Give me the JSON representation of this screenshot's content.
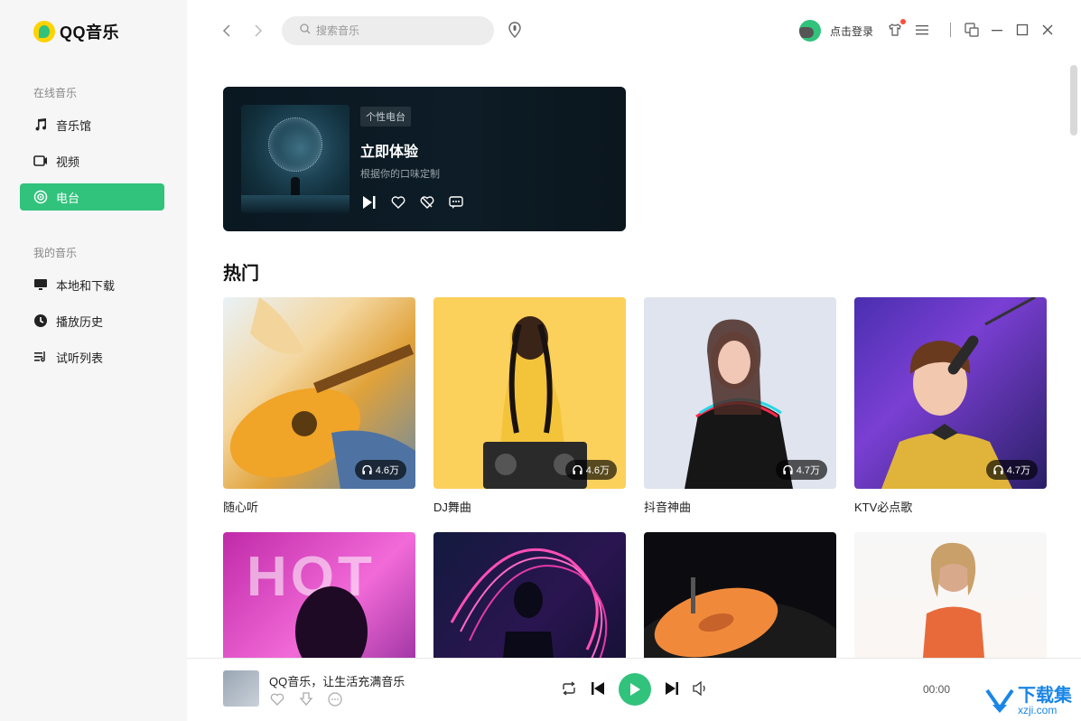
{
  "app": {
    "name": "QQ音乐"
  },
  "sidebar": {
    "online_title": "在线音乐",
    "online_items": [
      {
        "label": "音乐馆",
        "icon": "music-note-icon"
      },
      {
        "label": "视频",
        "icon": "video-icon"
      },
      {
        "label": "电台",
        "icon": "radio-icon",
        "active": true
      }
    ],
    "mine_title": "我的音乐",
    "mine_items": [
      {
        "label": "本地和下载",
        "icon": "monitor-icon"
      },
      {
        "label": "播放历史",
        "icon": "clock-icon"
      },
      {
        "label": "试听列表",
        "icon": "playlist-icon"
      }
    ]
  },
  "topbar": {
    "search_placeholder": "搜索音乐",
    "login_label": "点击登录"
  },
  "banner": {
    "tag": "个性电台",
    "title": "立即体验",
    "subtitle": "根据你的口味定制"
  },
  "hot": {
    "title": "热门",
    "cards": [
      {
        "name": "随心听",
        "count": "4.6万"
      },
      {
        "name": "DJ舞曲",
        "count": "4.6万"
      },
      {
        "name": "抖音神曲",
        "count": "4.7万"
      },
      {
        "name": "KTV必点歌",
        "count": "4.7万"
      }
    ],
    "row2_text": "HOT"
  },
  "player": {
    "title": "QQ音乐，让生活充满音乐",
    "time": "00:00"
  },
  "watermark": {
    "cn": "下载集",
    "en": "xzji.com"
  },
  "colors": {
    "accent": "#31c27c",
    "badge": "#ff4c3a"
  }
}
